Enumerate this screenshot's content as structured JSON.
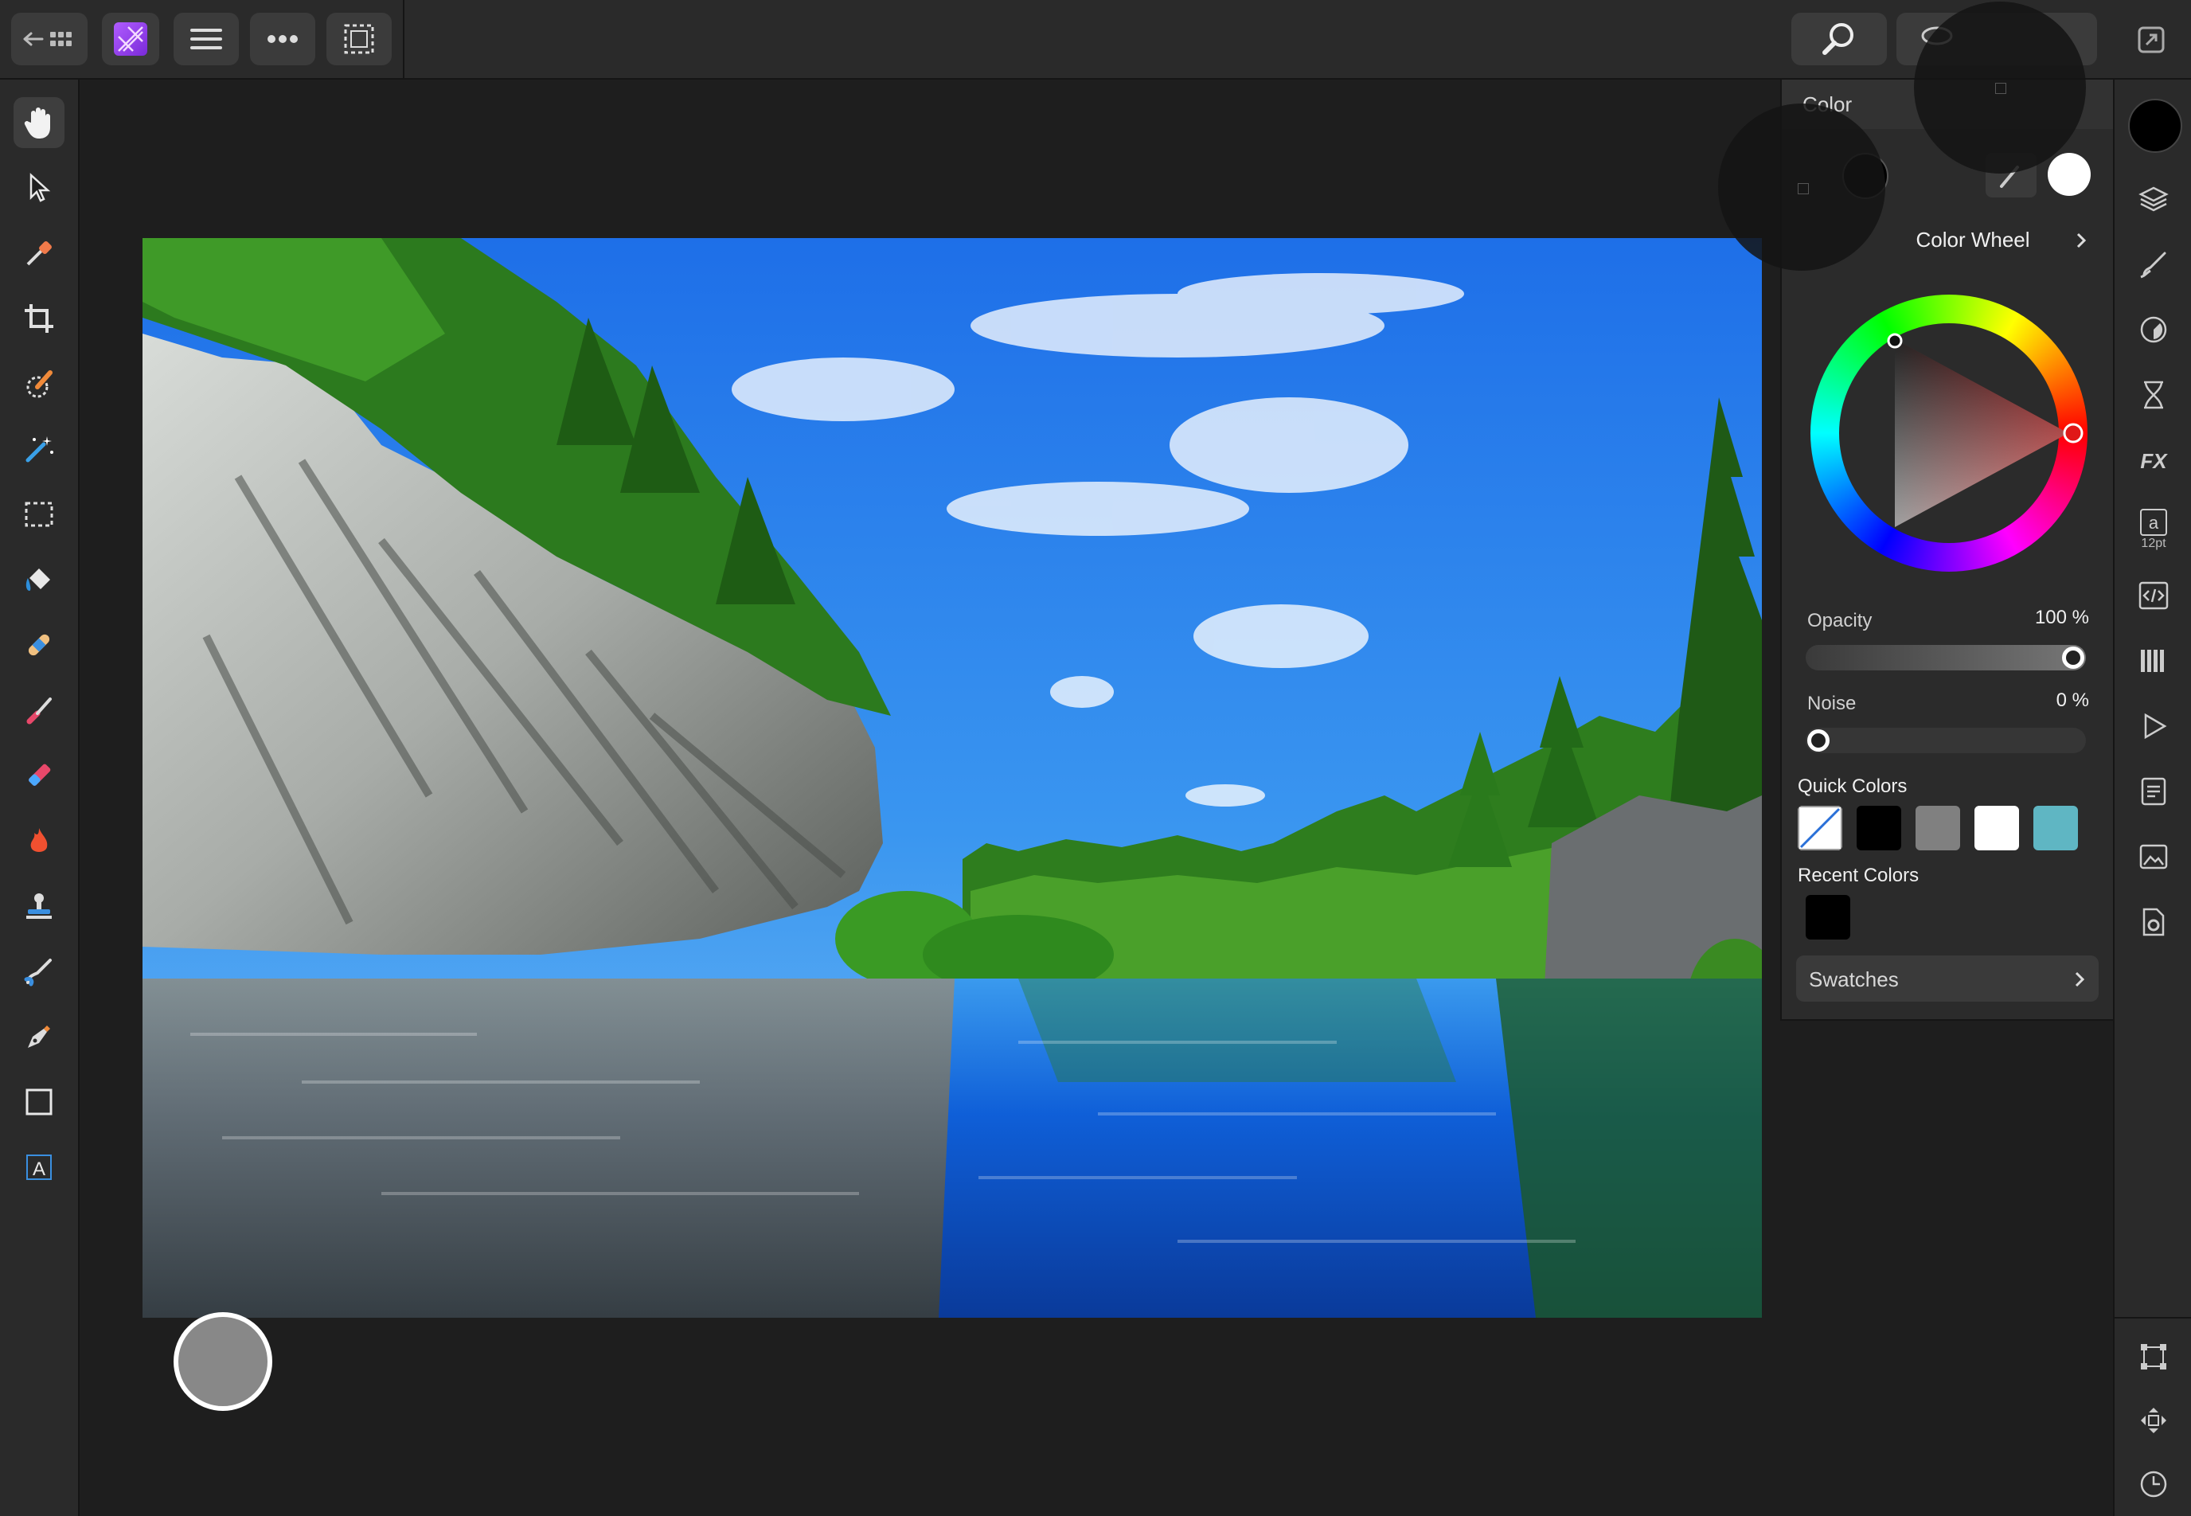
{
  "toolbar": {
    "back_icon": "back-to-gallery-icon",
    "app_icon": "affinity-photo-logo",
    "menu_icon": "hamburger-icon",
    "more_icon": "more-icon",
    "selection_icon": "selection-mode-icon",
    "right_tools": [
      "magnifier-icon",
      "lasso-icon",
      "expand-icon"
    ]
  },
  "tools": [
    {
      "name": "hand-tool",
      "icon": "hand-icon",
      "active": true
    },
    {
      "name": "move-tool",
      "icon": "arrow-pointer-icon"
    },
    {
      "name": "color-picker-tool",
      "icon": "eyedropper-icon"
    },
    {
      "name": "crop-tool",
      "icon": "crop-icon"
    },
    {
      "name": "selection-brush-tool",
      "icon": "selection-brush-icon"
    },
    {
      "name": "flood-select-tool",
      "icon": "magic-wand-icon"
    },
    {
      "name": "rectangular-marquee-tool",
      "icon": "marquee-icon"
    },
    {
      "name": "flood-fill-tool",
      "icon": "paint-bucket-icon"
    },
    {
      "name": "healing-tool",
      "icon": "bandage-icon"
    },
    {
      "name": "paint-brush-tool",
      "icon": "brush-icon"
    },
    {
      "name": "erase-brush-tool",
      "icon": "eraser-icon"
    },
    {
      "name": "burn-brush-tool",
      "icon": "flame-icon"
    },
    {
      "name": "clone-brush-tool",
      "icon": "stamp-icon"
    },
    {
      "name": "smudge-brush-tool",
      "icon": "smudge-icon"
    },
    {
      "name": "pen-tool",
      "icon": "pen-nib-icon"
    },
    {
      "name": "rectangle-tool",
      "icon": "square-icon"
    },
    {
      "name": "text-tool",
      "icon": "text-frame-icon"
    }
  ],
  "color_panel": {
    "title": "Color",
    "mode": "Color Wheel",
    "opacity_label": "Opacity",
    "opacity_value": "100 %",
    "opacity_fraction": 1.0,
    "noise_label": "Noise",
    "noise_value": "0 %",
    "noise_fraction": 0.0,
    "quick_colors_label": "Quick Colors",
    "quick_colors": [
      "none",
      "#000000",
      "#808080",
      "#ffffff",
      "#5fb6c3"
    ],
    "recent_colors_label": "Recent Colors",
    "recent_colors": [
      "#000000"
    ],
    "swatches_label": "Swatches",
    "primary_color": "#000000",
    "secondary_color": "#ffffff",
    "hue_color": "#e01818"
  },
  "studio": {
    "items": [
      {
        "name": "studio-layers",
        "icon": "layers-icon"
      },
      {
        "name": "studio-brushes",
        "icon": "brushes-icon"
      },
      {
        "name": "studio-adjustments",
        "icon": "adjustments-icon"
      },
      {
        "name": "studio-history",
        "icon": "hourglass-icon"
      },
      {
        "name": "studio-fx",
        "icon": "fx-icon"
      },
      {
        "name": "studio-text",
        "icon": "text-style-icon",
        "caption": "12pt"
      },
      {
        "name": "studio-navigator",
        "icon": "code-icon"
      },
      {
        "name": "studio-channels",
        "icon": "channels-icon"
      },
      {
        "name": "studio-macros",
        "icon": "play-icon"
      },
      {
        "name": "studio-stock",
        "icon": "styles-icon"
      },
      {
        "name": "studio-export",
        "icon": "image-icon"
      },
      {
        "name": "studio-settings",
        "icon": "document-gear-icon"
      },
      {
        "name": "studio-transform",
        "icon": "transform-icon"
      },
      {
        "name": "studio-nudge",
        "icon": "move-arrows-icon"
      },
      {
        "name": "studio-history-clock",
        "icon": "clock-icon"
      }
    ],
    "text_caption": "12pt"
  }
}
